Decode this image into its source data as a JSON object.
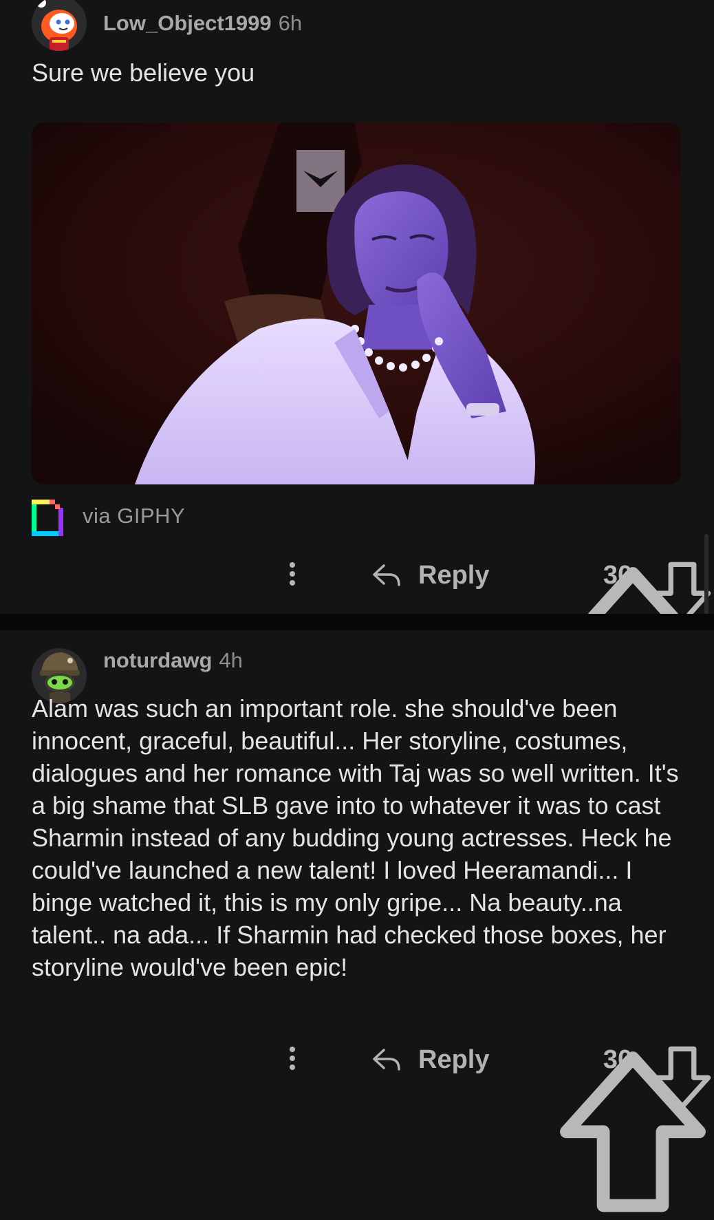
{
  "comments": [
    {
      "author": "Low_Object1999",
      "age": "6h",
      "avatar": "reddit-snoo-avatar",
      "body": "Sure we believe you",
      "gif_attribution": "via GIPHY",
      "actions": {
        "reply_label": "Reply",
        "score": "30"
      }
    },
    {
      "author": "noturdawg",
      "age": "4h",
      "avatar": "robot-helmet-avatar",
      "body": "Alam was such an important role. she should've been innocent, graceful, beautiful... Her storyline, costumes, dialogues and her romance with Taj was so well written. It's a big shame that SLB gave into to whatever it was to cast Sharmin instead of any budding young actresses. Heck he could've launched a new talent! I loved Heeramandi... I binge watched it, this is my only gripe... Na beauty..na talent.. na ada... If Sharmin had checked those boxes, her storyline would've been epic!",
      "actions": {
        "reply_label": "Reply",
        "score": "30"
      }
    }
  ],
  "colors": {
    "background": "#141416",
    "separator": "#070708",
    "text": "#e4e4e6",
    "muted": "#a2a2a4"
  }
}
